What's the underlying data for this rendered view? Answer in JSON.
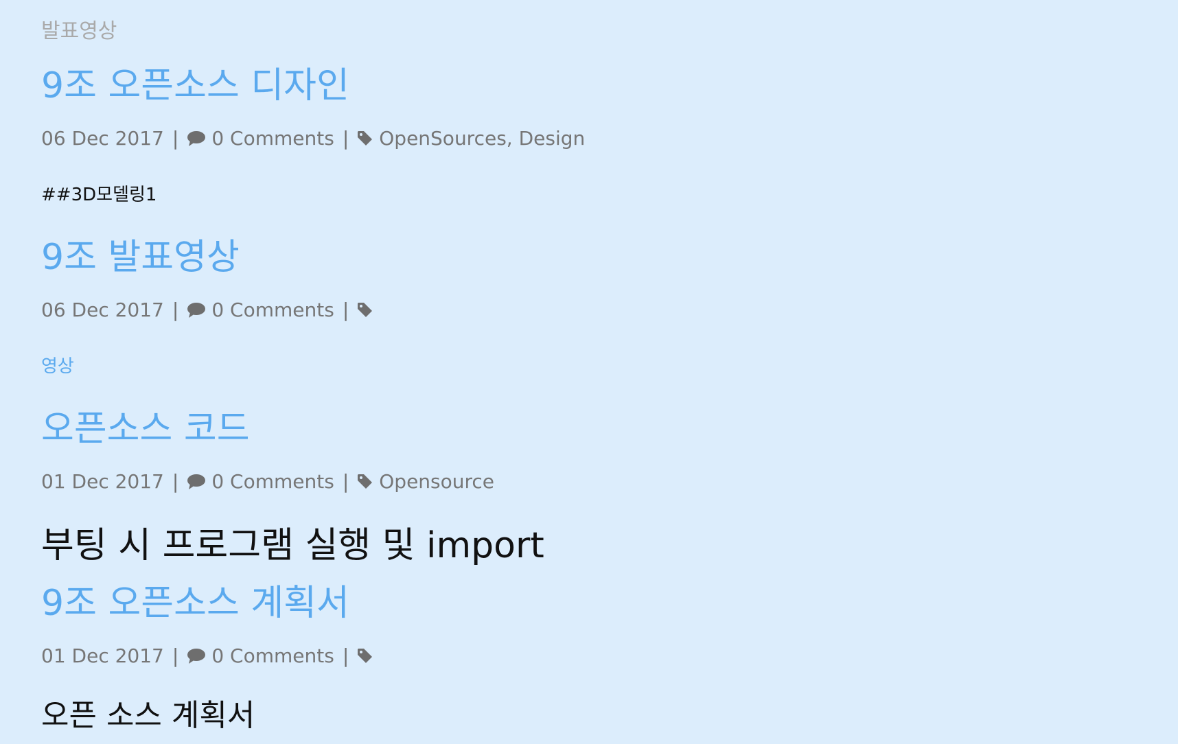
{
  "top_excerpt": "발표영상",
  "posts": [
    {
      "title": "9조 오픈소스 디자인",
      "date": "06 Dec 2017",
      "comments": "0 Comments",
      "tags": "OpenSources, Design",
      "excerpt": "##3D모델링1"
    },
    {
      "title": "9조 발표영상",
      "date": "06 Dec 2017",
      "comments": "0 Comments",
      "tags": "",
      "excerpt": "영상"
    },
    {
      "title": "오픈소스 코드",
      "date": "01 Dec 2017",
      "comments": "0 Comments",
      "tags": "Opensource",
      "excerpt": "부팅 시 프로그램 실행 및 import"
    },
    {
      "title": "9조 오픈소스 계획서",
      "date": "01 Dec 2017",
      "comments": "0 Comments",
      "tags": "",
      "excerpt": "오픈 소스 계획서"
    }
  ],
  "separator": "|",
  "icons": {
    "comment": "comment-icon",
    "tag": "tag-icon"
  },
  "colors": {
    "background": "#dcedfc",
    "link": "#5aa9ee",
    "meta": "#767676",
    "muted": "#a9a9a9"
  }
}
